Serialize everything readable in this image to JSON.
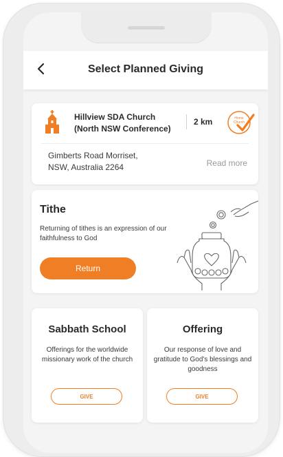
{
  "header": {
    "title": "Select Planned Giving",
    "back_icon": "chevron-left-icon"
  },
  "church": {
    "name": "Hillview SDA Church\n(North NSW Conference)",
    "distance": "2 km",
    "badge_label": "Home Church",
    "address": "Gimberts Road Morriset,\nNSW, Australia 2264",
    "read_more": "Read more",
    "icon": "church-icon"
  },
  "tithe": {
    "title": "Tithe",
    "description": "Returning of tithes is an expression of our faithfulness to God",
    "button_label": "Return",
    "illustration": "donation-jar-illustration"
  },
  "sabbath_school": {
    "title": "Sabbath School",
    "description": "Offerings for the worldwide missionary work of the church",
    "button_label": "GIVE"
  },
  "offering": {
    "title": "Offering",
    "description": "Our response of love and gratitude to God's blessings and goodness",
    "button_label": "GIVE"
  },
  "colors": {
    "accent": "#f07e24",
    "background": "#f4f4f4",
    "card": "#ffffff",
    "text": "#2a2a2a",
    "muted": "#9a9a9a"
  }
}
